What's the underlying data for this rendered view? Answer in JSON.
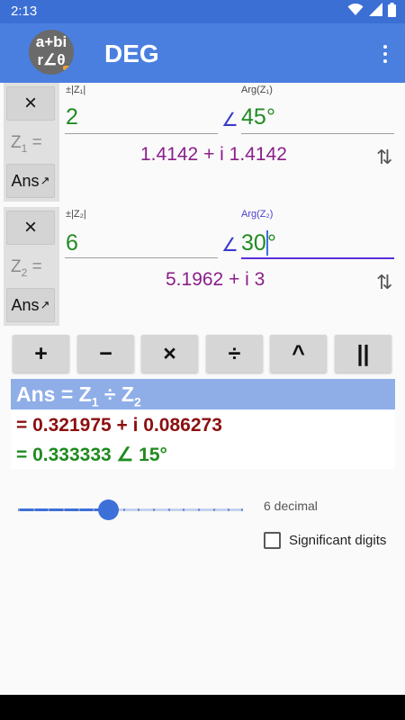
{
  "status_bar": {
    "time": "2:13",
    "icons": [
      "wifi-icon",
      "signal-icon",
      "battery-icon"
    ]
  },
  "app_bar": {
    "logo_top": "a+bi",
    "logo_bottom": "r∠θ",
    "title": "DEG",
    "menu_icon": "overflow-menu-icon"
  },
  "z1": {
    "clear_label": "×",
    "name": "Z",
    "sub": "1",
    "eq": " =",
    "ans_label": "Ans",
    "ans_icon": "↗",
    "mod_label": "±|Z₁|",
    "mod_value": "2",
    "angle_symbol": "∠",
    "arg_label": "Arg(Z₁)",
    "arg_value": "45",
    "degree": "°",
    "rect_result": "1.4142 + i 1.4142",
    "swap_icon": "⇅"
  },
  "z2": {
    "clear_label": "×",
    "name": "Z",
    "sub": "2",
    "eq": " =",
    "ans_label": "Ans",
    "ans_icon": "↗",
    "mod_label": "±|Z₂|",
    "mod_value": "6",
    "angle_symbol": "∠",
    "arg_label": "Arg(Z₂)",
    "arg_value": "30",
    "degree": "°",
    "rect_result": "5.1962 + i 3",
    "swap_icon": "⇅"
  },
  "operations": [
    "+",
    "−",
    "×",
    "÷",
    "^",
    "||"
  ],
  "answer": {
    "prefix": "Ans = Z",
    "sub1": "1",
    "op": " ÷ Z",
    "sub2": "2",
    "rectangular": "= 0.321975 + i 0.086273",
    "polar": "= 0.333333 ∠ 15°"
  },
  "precision": {
    "label": "6 decimal",
    "value": 6,
    "max": 15
  },
  "significant_digits": {
    "label": "Significant digits",
    "checked": false
  },
  "colors": {
    "app_bar": "#4a7fe0",
    "status_bar": "#3b6fd4",
    "answer_header": "#8faee8",
    "input_green": "#228b22",
    "rect_purple": "#8b1f8b",
    "answer_red": "#8b1010"
  }
}
